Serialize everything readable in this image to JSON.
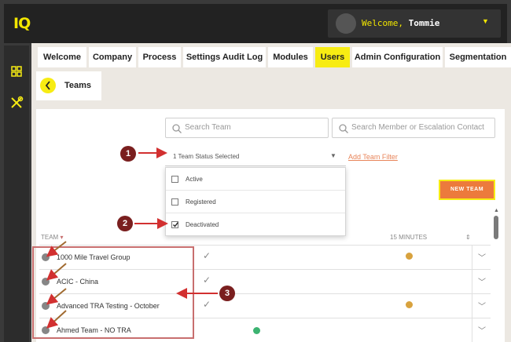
{
  "app": {
    "logo": "IQ"
  },
  "user": {
    "greeting": "Welcome,",
    "name": "Tommie"
  },
  "tabs": [
    {
      "label": "Welcome"
    },
    {
      "label": "Company"
    },
    {
      "label": "Process"
    },
    {
      "label": "Settings Audit Log"
    },
    {
      "label": "Modules"
    },
    {
      "label": "Users",
      "active": true
    },
    {
      "label": "Admin Configuration"
    },
    {
      "label": "Segmentation"
    }
  ],
  "section": {
    "title": "Teams"
  },
  "search": {
    "team_placeholder": "Search Team",
    "member_placeholder": "Search Member or Escalation Contact"
  },
  "filter": {
    "status_selected": "1 Team Status Selected",
    "add_filter_link": "Add Team Filter",
    "options": [
      {
        "label": "Active",
        "checked": false
      },
      {
        "label": "Registered",
        "checked": false
      },
      {
        "label": "Deactivated",
        "checked": true
      }
    ]
  },
  "new_team_button": "NEW TEAM",
  "table": {
    "columns": {
      "team": "TEAM",
      "fifteen": "15 MINUTES"
    },
    "rows": [
      {
        "name": "1000 Mile Travel Group",
        "check": "✓",
        "status": "amber"
      },
      {
        "name": "ACIC - China",
        "check": "✓",
        "status": "none"
      },
      {
        "name": "Advanced TRA Testing - October",
        "check": "✓",
        "status": "amber"
      },
      {
        "name": "Ahmed Team - NO TRA",
        "check": "",
        "status": "green"
      }
    ]
  },
  "annotations": [
    "1",
    "2",
    "3"
  ],
  "colors": {
    "accent": "#f7ec13",
    "button": "#ec7a3c",
    "annotation": "#7a1f1f",
    "link": "#e8855a"
  }
}
